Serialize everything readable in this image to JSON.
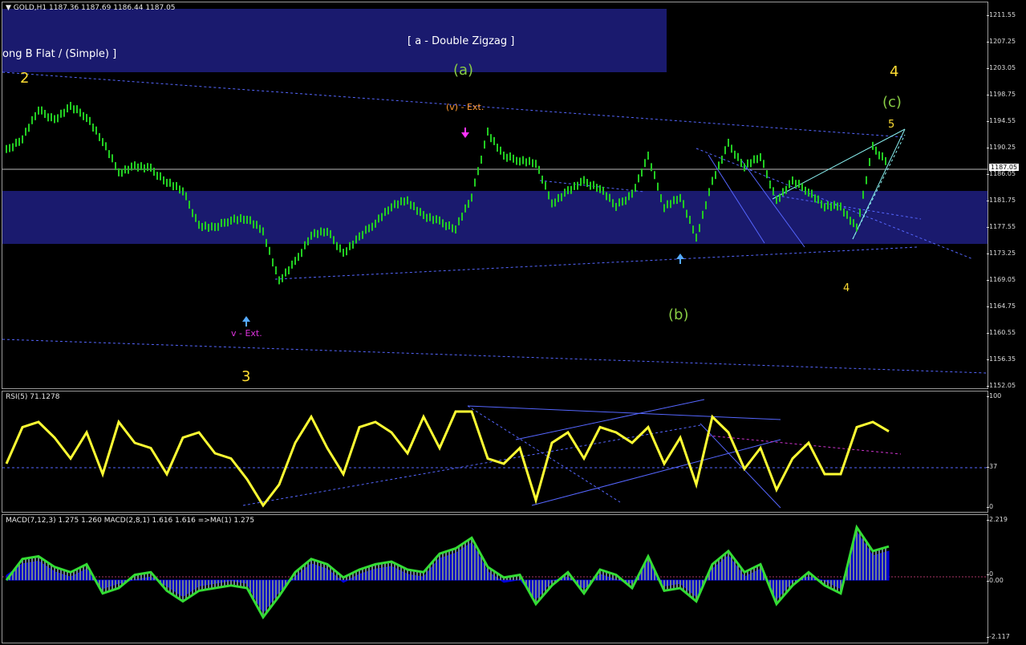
{
  "header": {
    "symbol": "GOLD,H1",
    "open": "1187.36",
    "high": "1187.69",
    "low": "1186.44",
    "close": "1187.05",
    "current_price": "1187.05"
  },
  "price_axis": [
    "1211.55",
    "1207.25",
    "1203.05",
    "1198.75",
    "1194.55",
    "1190.25",
    "1186.05",
    "1181.75",
    "1177.55",
    "1173.25",
    "1169.05",
    "1164.75",
    "1160.55",
    "1156.35",
    "1152.05"
  ],
  "rsi": {
    "label": "RSI(5) 71.1278",
    "axis": [
      "100",
      "37",
      "0"
    ]
  },
  "macd": {
    "label": "MACD(7,12,3) 1.275 1.260  MACD(2,8,1) 1.616 1.616  =>MA(1) 1.275",
    "axis": [
      "2.219",
      "0",
      "0.00",
      "-2.117"
    ]
  },
  "boxes": {
    "top_left_text": "ong B Flat / (Simple) ]",
    "top_center_text": "[ a - Double Zigzag ]"
  },
  "annotations": {
    "arrow_label_v_ext": "v - Ext.",
    "arrow_label_v_ext_c": "(v) - Ext.",
    "label_2": "2",
    "label_3": "3",
    "label_4_big": "4",
    "label_c_big": "(c)",
    "label_a_big": "(a)",
    "label_b_big": "(b)",
    "label_5": "5",
    "label_4_small": "4"
  },
  "colors": {
    "candles": "#22cc22",
    "band": "#1a1a6e",
    "rsi_line": "#ffff33",
    "macd_line": "#33dd33",
    "macd_fill": "#0000cc",
    "trendline": "#5566ff",
    "wave_orange": "#ff7722",
    "wave_yellow": "#ffdd33",
    "wave_green": "#88cc44",
    "wave_magenta": "#dd33dd",
    "wave_white": "#e0e0e0",
    "wave_cyan": "#55aaff"
  },
  "chart_data": [
    {
      "type": "line",
      "name": "price",
      "title": "GOLD,H1",
      "ylim": [
        1152.05,
        1211.55
      ],
      "x": [
        0,
        20,
        40,
        60,
        80,
        100,
        120,
        140,
        160,
        180,
        200,
        220,
        240,
        260,
        280,
        300,
        320,
        340,
        360,
        380,
        400,
        420,
        440,
        460,
        480,
        500,
        520,
        540,
        560,
        580,
        600,
        620,
        640,
        660,
        680,
        700,
        720,
        740,
        760,
        780,
        800,
        820,
        840,
        860,
        880,
        900,
        920,
        940,
        960,
        980,
        1000,
        1020,
        1040,
        1060,
        1080,
        1100
      ],
      "values": [
        1189.0,
        1191.0,
        1195.5,
        1194.0,
        1196.0,
        1194.5,
        1190.5,
        1185.5,
        1186.5,
        1186.0,
        1184.0,
        1182.5,
        1177.0,
        1176.5,
        1178.0,
        1178.0,
        1176.0,
        1168.0,
        1171.0,
        1175.5,
        1176.0,
        1172.5,
        1175.0,
        1177.5,
        1180.0,
        1181.0,
        1178.5,
        1177.5,
        1176.5,
        1181.5,
        1192.0,
        1188.0,
        1187.5,
        1187.0,
        1180.5,
        1182.5,
        1184.0,
        1183.0,
        1180.0,
        1182.0,
        1188.0,
        1180.0,
        1181.5,
        1175.0,
        1184.0,
        1190.0,
        1186.5,
        1188.0,
        1181.0,
        1184.0,
        1182.5,
        1180.0,
        1180.0,
        1176.5,
        1189.5,
        1187.0
      ]
    },
    {
      "type": "line",
      "name": "RSI(5)",
      "ylim": [
        0,
        100
      ],
      "x": [
        0,
        20,
        40,
        60,
        80,
        100,
        120,
        140,
        160,
        180,
        200,
        220,
        240,
        260,
        280,
        300,
        320,
        340,
        360,
        380,
        400,
        420,
        440,
        460,
        480,
        500,
        520,
        540,
        560,
        580,
        600,
        620,
        640,
        660,
        680,
        700,
        720,
        740,
        760,
        780,
        800,
        820,
        840,
        860,
        880,
        900,
        920,
        940,
        960,
        980,
        1000,
        1020,
        1040,
        1060,
        1080,
        1100
      ],
      "values": [
        40,
        75,
        80,
        65,
        45,
        70,
        30,
        80,
        60,
        55,
        30,
        65,
        70,
        50,
        45,
        25,
        0,
        20,
        60,
        85,
        55,
        30,
        75,
        80,
        70,
        50,
        85,
        55,
        90,
        90,
        45,
        40,
        55,
        5,
        60,
        70,
        45,
        75,
        70,
        60,
        75,
        40,
        65,
        20,
        85,
        70,
        35,
        55,
        15,
        45,
        60,
        30,
        30,
        75,
        80,
        71
      ]
    },
    {
      "type": "line",
      "name": "MACD(7,12,3)",
      "ylim": [
        -2.117,
        2.219
      ],
      "x": [
        0,
        20,
        40,
        60,
        80,
        100,
        120,
        140,
        160,
        180,
        200,
        220,
        240,
        260,
        280,
        300,
        320,
        340,
        360,
        380,
        400,
        420,
        440,
        460,
        480,
        500,
        520,
        540,
        560,
        580,
        600,
        620,
        640,
        660,
        680,
        700,
        720,
        740,
        760,
        780,
        800,
        820,
        840,
        860,
        880,
        900,
        920,
        940,
        960,
        980,
        1000,
        1020,
        1040,
        1060,
        1080,
        1100
      ],
      "values": [
        0.0,
        0.8,
        0.9,
        0.5,
        0.3,
        0.6,
        -0.5,
        -0.3,
        0.2,
        0.3,
        -0.4,
        -0.8,
        -0.4,
        -0.3,
        -0.2,
        -0.3,
        -1.4,
        -0.6,
        0.3,
        0.8,
        0.6,
        0.1,
        0.4,
        0.6,
        0.7,
        0.4,
        0.3,
        1.0,
        1.2,
        1.6,
        0.5,
        0.1,
        0.2,
        -0.9,
        -0.2,
        0.3,
        -0.5,
        0.4,
        0.2,
        -0.3,
        0.9,
        -0.4,
        -0.3,
        -0.8,
        0.6,
        1.1,
        0.3,
        0.6,
        -0.9,
        -0.2,
        0.3,
        -0.2,
        -0.5,
        2.0,
        1.1,
        1.275
      ]
    }
  ]
}
